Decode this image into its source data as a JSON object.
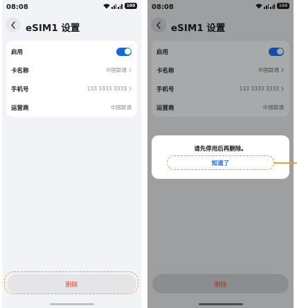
{
  "accent_color": "#1668d8",
  "delete_color": "#e8452c",
  "highlight_color": "#f09a37",
  "left_screen": {
    "status_bar": {
      "time": "08:08",
      "battery": "100",
      "icons": [
        "wifi-icon",
        "signal-icon",
        "signal-icon",
        "battery-icon"
      ]
    },
    "title": "eSIM1 设置",
    "rows": [
      {
        "label": "启用",
        "toggle_on": true
      },
      {
        "label": "卡名称",
        "value": "中国联通"
      },
      {
        "label": "手机号",
        "value": "133 3333 3333"
      },
      {
        "label": "运营商",
        "value": "中国联通"
      }
    ],
    "delete_button": "删除"
  },
  "right_screen": {
    "status_bar": {
      "time": "08:08",
      "battery": "100"
    },
    "title": "eSIM1 设置",
    "rows": [
      {
        "label": "启用",
        "toggle_on": true
      },
      {
        "label": "卡名称",
        "value": "中国联通"
      },
      {
        "label": "手机号",
        "value": "133 3333 3333"
      },
      {
        "label": "运营商",
        "value": "中国联通"
      }
    ],
    "dialog": {
      "message": "请先停用后再删除。",
      "button": "知道了"
    },
    "delete_button": "删除"
  }
}
